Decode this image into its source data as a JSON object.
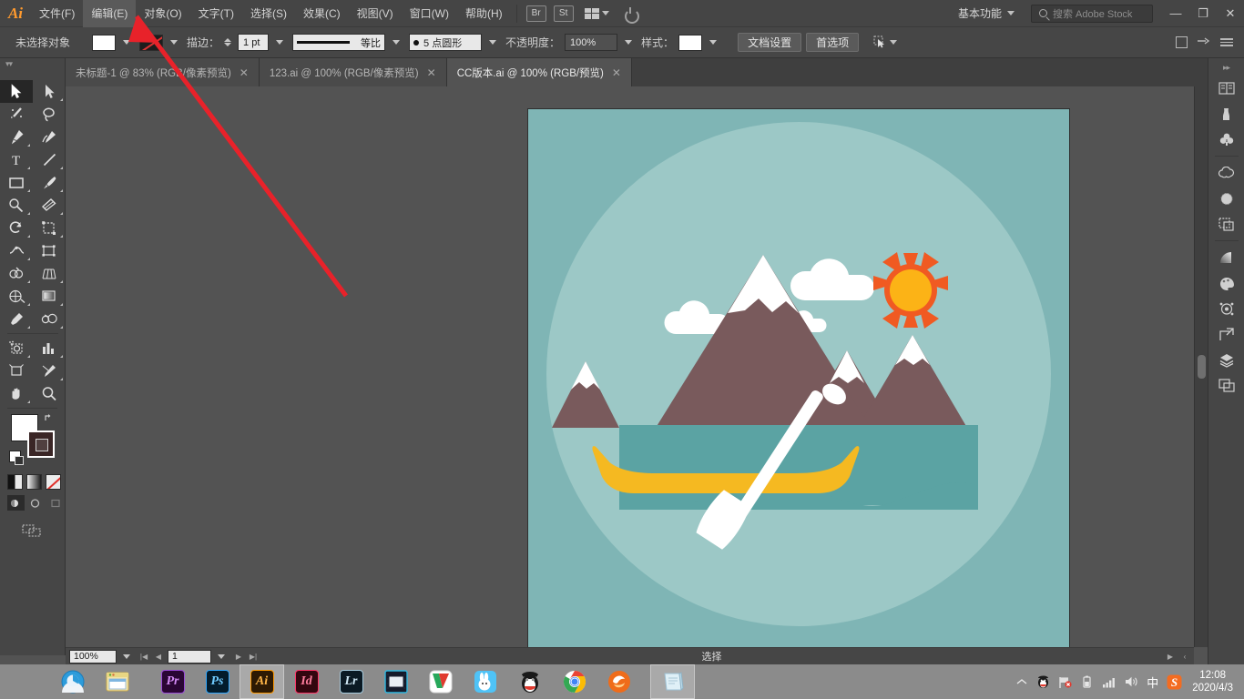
{
  "app": {
    "logo": "Ai",
    "menus": [
      {
        "label": "文件(F)",
        "name": "menu-file"
      },
      {
        "label": "编辑(E)",
        "name": "menu-edit",
        "highlighted": true
      },
      {
        "label": "对象(O)",
        "name": "menu-object"
      },
      {
        "label": "文字(T)",
        "name": "menu-type"
      },
      {
        "label": "选择(S)",
        "name": "menu-select"
      },
      {
        "label": "效果(C)",
        "name": "menu-effect"
      },
      {
        "label": "视图(V)",
        "name": "menu-view"
      },
      {
        "label": "窗口(W)",
        "name": "menu-window"
      },
      {
        "label": "帮助(H)",
        "name": "menu-help"
      }
    ],
    "bridge_label": "Br",
    "stock_label": "St",
    "workspace": "基本功能",
    "search_placeholder": "搜索 Adobe Stock",
    "window_buttons": {
      "minimize": "—",
      "restore": "❐",
      "close": "✕"
    }
  },
  "controlbar": {
    "selection_label": "未选择对象",
    "fill_label": "填色",
    "stroke_label": "描边：",
    "stroke_weight": "1 pt",
    "stroke_profile": "等比",
    "brush_label": "5 点圆形",
    "opacity_label": "不透明度：",
    "opacity_value": "100%",
    "style_label": "样式：",
    "doc_setup": "文档设置",
    "preferences": "首选项"
  },
  "tabs": [
    {
      "label": "未标题-1 @ 83% (RGB/像素预览)",
      "active": false,
      "close": "✕"
    },
    {
      "label": "123.ai @ 100% (RGB/像素预览)",
      "active": false,
      "close": "✕"
    },
    {
      "label": "CC版本.ai @ 100% (RGB/预览)",
      "active": true,
      "close": "✕"
    }
  ],
  "toolbar": {
    "tools": [
      {
        "name": "selection-tool",
        "label": "选择工具",
        "selected": true
      },
      {
        "name": "direct-selection-tool",
        "label": "直接选择工具",
        "corner": true
      },
      {
        "name": "magic-wand-tool",
        "label": "魔棒工具"
      },
      {
        "name": "lasso-tool",
        "label": "套索工具"
      },
      {
        "name": "pen-tool",
        "label": "钢笔工具",
        "corner": true
      },
      {
        "name": "curvature-tool",
        "label": "曲率工具"
      },
      {
        "name": "type-tool",
        "label": "文字工具",
        "corner": true
      },
      {
        "name": "line-segment-tool",
        "label": "直线段工具",
        "corner": true
      },
      {
        "name": "rectangle-tool",
        "label": "矩形工具",
        "corner": true
      },
      {
        "name": "paintbrush-tool",
        "label": "画笔工具",
        "corner": true
      },
      {
        "name": "shaper-tool",
        "label": "Shaper 工具",
        "corner": true
      },
      {
        "name": "eraser-tool",
        "label": "橡皮擦工具",
        "corner": true
      },
      {
        "name": "rotate-tool",
        "label": "旋转工具",
        "corner": true
      },
      {
        "name": "scale-tool",
        "label": "比例缩放工具",
        "corner": true
      },
      {
        "name": "width-tool",
        "label": "宽度工具",
        "corner": true
      },
      {
        "name": "free-transform-tool",
        "label": "自由变换工具"
      },
      {
        "name": "shape-builder-tool",
        "label": "形状生成器工具",
        "corner": true
      },
      {
        "name": "perspective-grid-tool",
        "label": "透视网格工具",
        "corner": true
      },
      {
        "name": "mesh-tool",
        "label": "网格工具"
      },
      {
        "name": "gradient-tool",
        "label": "渐变工具"
      },
      {
        "name": "eyedropper-tool",
        "label": "吸管工具",
        "corner": true
      },
      {
        "name": "blend-tool",
        "label": "混合工具"
      },
      {
        "name": "symbol-sprayer-tool",
        "label": "符号喷枪工具",
        "corner": true
      },
      {
        "name": "column-graph-tool",
        "label": "柱形图工具",
        "corner": true
      },
      {
        "name": "artboard-tool",
        "label": "画板工具"
      },
      {
        "name": "slice-tool",
        "label": "切片工具",
        "corner": true
      },
      {
        "name": "hand-tool",
        "label": "抓手工具",
        "corner": true
      },
      {
        "name": "zoom-tool",
        "label": "缩放工具"
      }
    ],
    "fill_color": "#ffffff",
    "stroke_color": "#3a2626",
    "color_modes": [
      {
        "name": "color-mode-button",
        "label": "颜色"
      },
      {
        "name": "gradient-mode-button",
        "label": "渐变"
      },
      {
        "name": "none-mode-button",
        "label": "无"
      }
    ],
    "screen_modes": [
      {
        "name": "normal-screen-mode",
        "label": "正常屏幕模式"
      },
      {
        "name": "full-screen-menu-mode",
        "label": "带有菜单栏的全屏模式"
      },
      {
        "name": "full-screen-mode",
        "label": "全屏模式"
      }
    ],
    "edit_toolbar_label": "编辑工具栏"
  },
  "statusbar": {
    "zoom": "100%",
    "page": "1",
    "status_text": "选择",
    "first": "|◀",
    "prev": "◀",
    "next": "▶",
    "last": "▶|"
  },
  "rightdock": {
    "panels": [
      {
        "name": "libraries-panel-icon",
        "label": "库"
      },
      {
        "name": "brushes-panel-icon",
        "label": "画笔"
      },
      {
        "name": "symbols-panel-icon",
        "label": "符号"
      },
      {
        "name": "creative-cloud-panel-icon",
        "label": "Creative Cloud"
      },
      {
        "name": "color-panel-icon",
        "label": "颜色"
      },
      {
        "name": "color-guide-panel-icon",
        "label": "颜色参考"
      },
      {
        "name": "gradient-panel-icon",
        "label": "渐变"
      },
      {
        "name": "swatches-panel-icon",
        "label": "色板"
      },
      {
        "name": "appearance-panel-icon",
        "label": "外观"
      },
      {
        "name": "transform-panel-icon",
        "label": "变换"
      },
      {
        "name": "layers-panel-icon",
        "label": "图层"
      },
      {
        "name": "artboards-panel-icon",
        "label": "画板"
      }
    ]
  },
  "artwork": {
    "title": "Flat canoe lake illustration",
    "colors": {
      "background": "#7fb5b5",
      "circle": "#9cc8c6",
      "water": "#5ba3a3",
      "mountain": "#795a5c",
      "snow": "#ffffff",
      "boat": "#f5b921",
      "sun_core": "#fcb316",
      "sun_rays": "#f05a22",
      "cloud": "#ffffff",
      "paddle": "#ffffff"
    }
  },
  "taskbar": {
    "items": [
      {
        "name": "taskbar-browser",
        "label": "浏览器"
      },
      {
        "name": "taskbar-file-explorer",
        "label": "文件资源管理器"
      },
      {
        "name": "taskbar-premiere",
        "label": "Pr"
      },
      {
        "name": "taskbar-photoshop",
        "label": "Ps"
      },
      {
        "name": "taskbar-illustrator",
        "label": "Ai",
        "active": true
      },
      {
        "name": "taskbar-indesign",
        "label": "Id"
      },
      {
        "name": "taskbar-lightroom",
        "label": "Lr"
      },
      {
        "name": "taskbar-video-editor",
        "label": "视频编辑器"
      },
      {
        "name": "taskbar-wps",
        "label": "WPS"
      },
      {
        "name": "taskbar-rabbit-app",
        "label": "兔兔助手"
      },
      {
        "name": "taskbar-qq",
        "label": "QQ"
      },
      {
        "name": "taskbar-chrome",
        "label": "Chrome"
      },
      {
        "name": "taskbar-firefox",
        "label": "Firefox"
      },
      {
        "name": "taskbar-notepad",
        "label": "便笺",
        "active": true
      }
    ],
    "tray": [
      {
        "name": "tray-show-hidden-icons",
        "label": "^"
      },
      {
        "name": "tray-qq-icon",
        "label": "QQ"
      },
      {
        "name": "tray-network-flag-icon",
        "label": "网络"
      },
      {
        "name": "tray-battery-icon",
        "label": "电池"
      },
      {
        "name": "tray-signal-icon",
        "label": "信号"
      },
      {
        "name": "tray-volume-icon",
        "label": "音量"
      },
      {
        "name": "tray-ime-icon",
        "label": "中"
      },
      {
        "name": "tray-sogou-icon",
        "label": "S"
      }
    ],
    "time": "12:08",
    "date": "2020/4/3"
  },
  "annotation": {
    "type": "arrow",
    "color": "#e8222a",
    "target": "编辑(E)"
  }
}
